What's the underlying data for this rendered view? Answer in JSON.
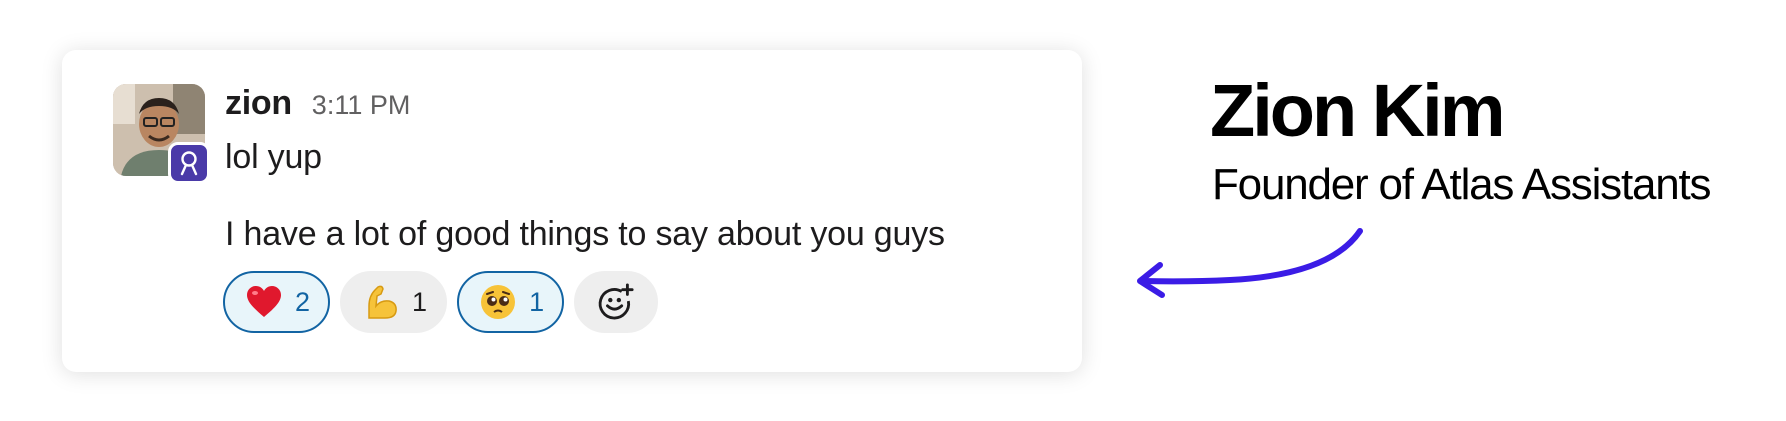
{
  "message": {
    "username": "zion",
    "timestamp": "3:11 PM",
    "lines": [
      "lol yup",
      "I have a lot of good things to say about you guys"
    ],
    "avatar_icon": "user-photo",
    "app_badge_icon": "atlas-app-badge-icon"
  },
  "reactions": [
    {
      "emoji": "red-heart-icon",
      "count": "2",
      "active": true
    },
    {
      "emoji": "flexed-biceps-icon",
      "count": "1",
      "active": false
    },
    {
      "emoji": "pleading-face-icon",
      "count": "1",
      "active": true
    }
  ],
  "add_reaction_icon": "add-reaction-icon",
  "annotation": {
    "name": "Zion Kim",
    "role": "Founder of Atlas Assistants",
    "arrow_color": "#3b1ce6"
  },
  "colors": {
    "reaction_active_border": "#1264a3",
    "reaction_active_bg": "#e8f5fa",
    "reaction_inactive_bg": "#eeeeee",
    "app_badge": "#4a3aa8"
  }
}
